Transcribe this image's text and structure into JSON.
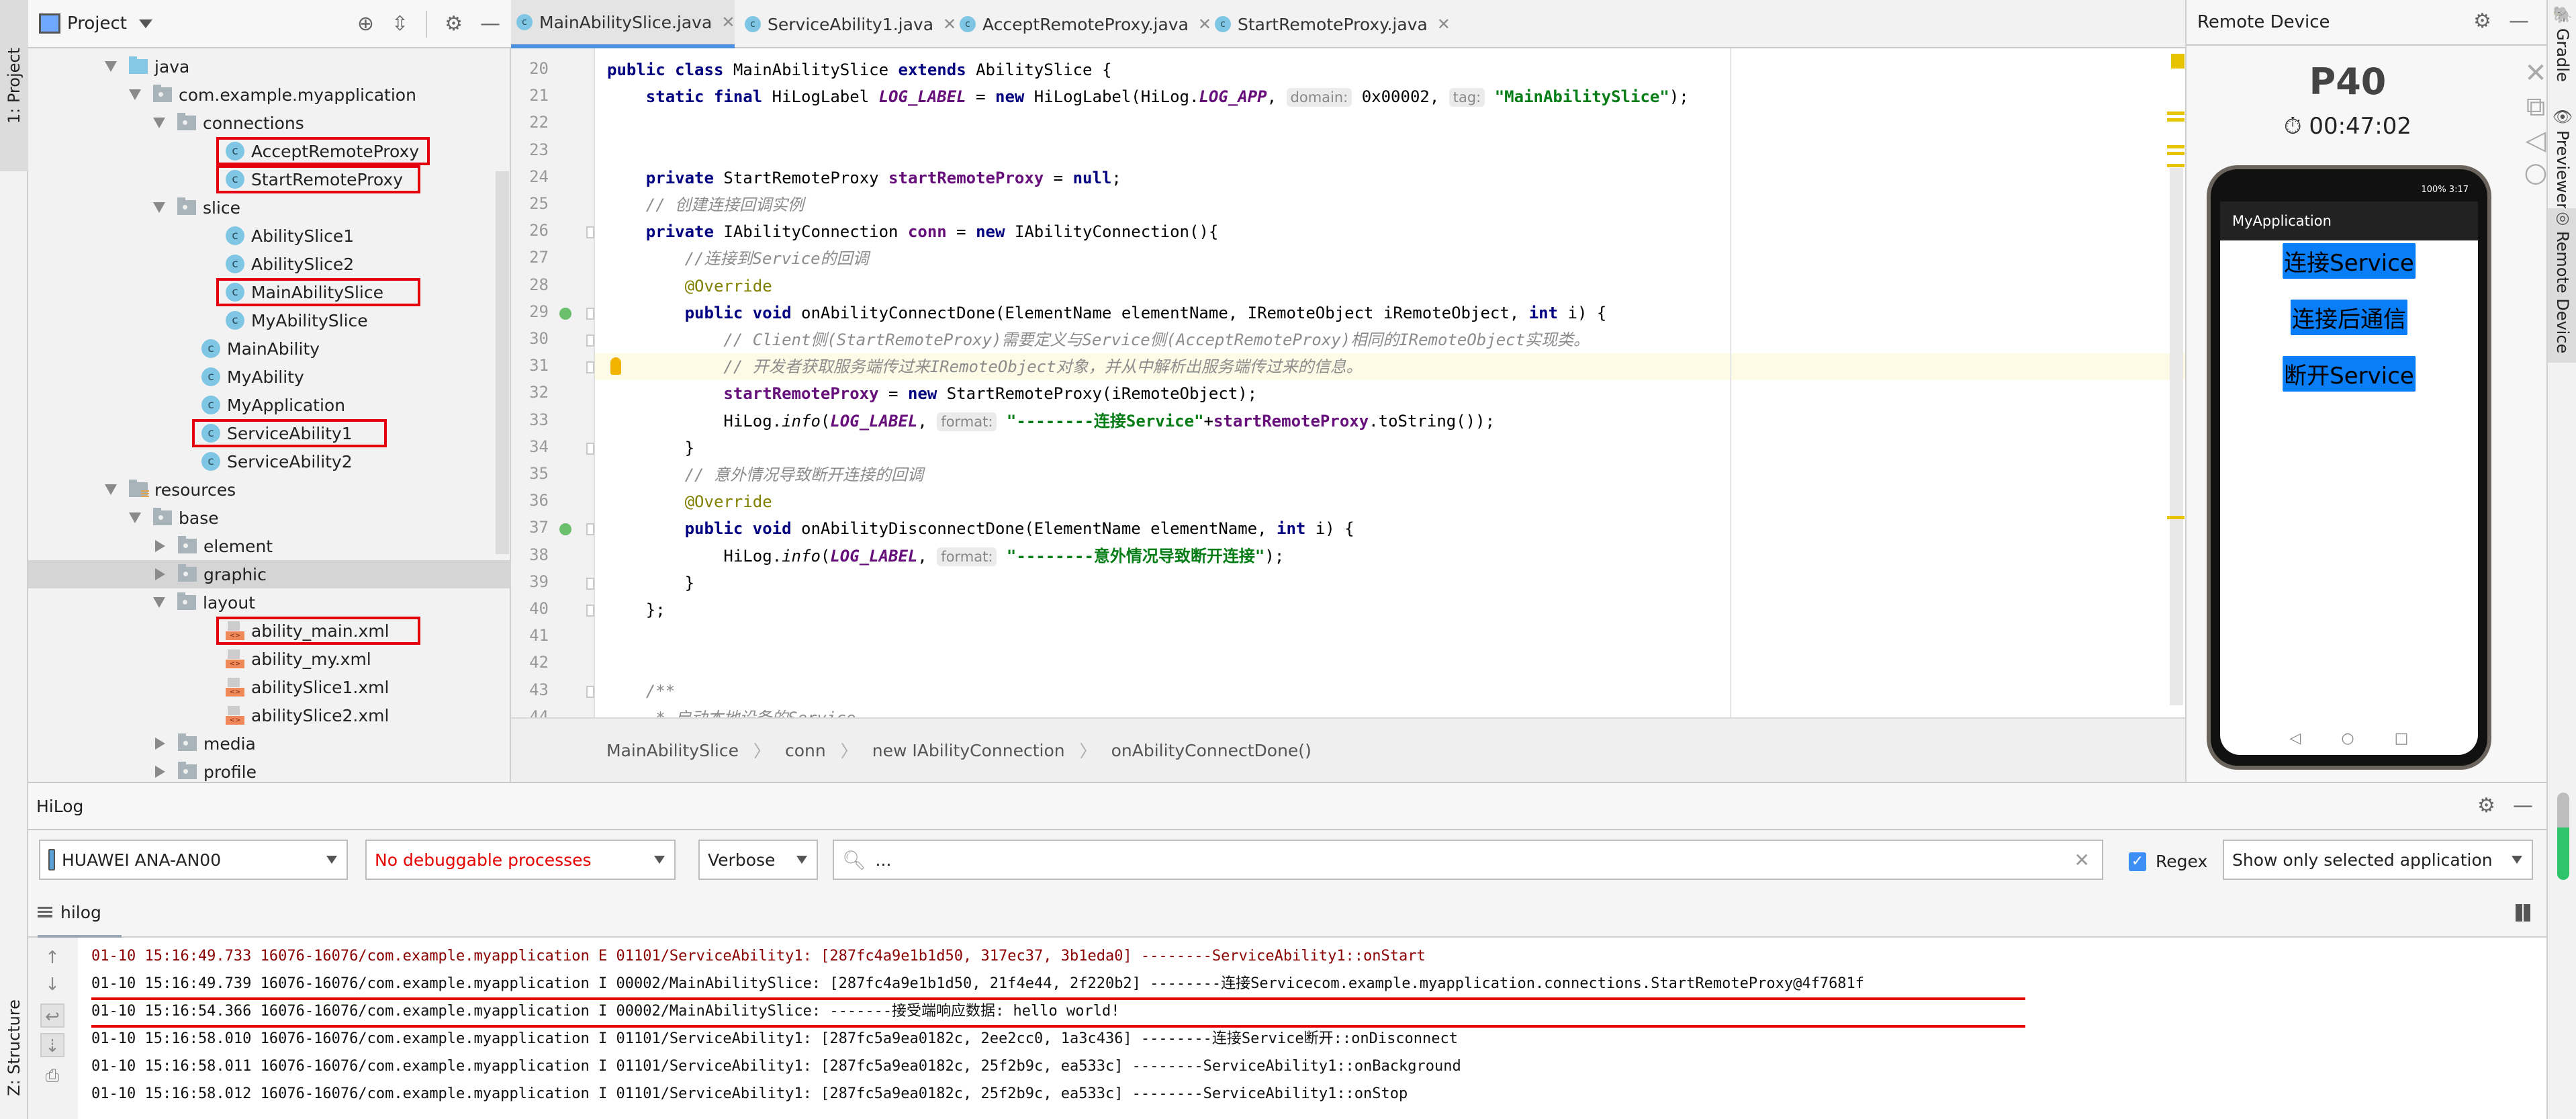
{
  "left_strip": {
    "project_tab": "1: Project",
    "structure_tab": "Z: Structure"
  },
  "project_panel": {
    "title": "Project",
    "icons": [
      "locate-icon",
      "collapse-all-icon",
      "gear-icon",
      "minimize-icon"
    ],
    "tree": [
      {
        "label": "java",
        "type": "source-folder",
        "depth": 0,
        "expanded": true
      },
      {
        "label": "com.example.myapplication",
        "type": "package",
        "depth": 1,
        "expanded": true
      },
      {
        "label": "connections",
        "type": "package",
        "depth": 2,
        "expanded": true
      },
      {
        "label": "AcceptRemoteProxy",
        "type": "class",
        "depth": 3,
        "highlighted": true
      },
      {
        "label": "StartRemoteProxy",
        "type": "class",
        "depth": 3,
        "highlighted": true
      },
      {
        "label": "slice",
        "type": "package",
        "depth": 2,
        "expanded": true
      },
      {
        "label": "AbilitySlice1",
        "type": "class",
        "depth": 3
      },
      {
        "label": "AbilitySlice2",
        "type": "class",
        "depth": 3
      },
      {
        "label": "MainAbilitySlice",
        "type": "class",
        "depth": 3,
        "highlighted": true
      },
      {
        "label": "MyAbilitySlice",
        "type": "class",
        "depth": 3
      },
      {
        "label": "MainAbility",
        "type": "class",
        "depth": 2
      },
      {
        "label": "MyAbility",
        "type": "class",
        "depth": 2
      },
      {
        "label": "MyApplication",
        "type": "class",
        "depth": 2
      },
      {
        "label": "ServiceAbility1",
        "type": "class",
        "depth": 2,
        "highlighted": true
      },
      {
        "label": "ServiceAbility2",
        "type": "class",
        "depth": 2
      },
      {
        "label": "resources",
        "type": "resource-folder",
        "depth": 0,
        "expanded": true
      },
      {
        "label": "base",
        "type": "folder",
        "depth": 1,
        "expanded": true
      },
      {
        "label": "element",
        "type": "folder",
        "depth": 2,
        "expanded": false
      },
      {
        "label": "graphic",
        "type": "folder",
        "depth": 2,
        "expanded": false,
        "selected": true
      },
      {
        "label": "layout",
        "type": "folder",
        "depth": 2,
        "expanded": true
      },
      {
        "label": "ability_main.xml",
        "type": "xml",
        "depth": 3,
        "highlighted": true
      },
      {
        "label": "ability_my.xml",
        "type": "xml",
        "depth": 3
      },
      {
        "label": "abilitySlice1.xml",
        "type": "xml",
        "depth": 3
      },
      {
        "label": "abilitySlice2.xml",
        "type": "xml",
        "depth": 3
      },
      {
        "label": "media",
        "type": "folder",
        "depth": 2,
        "expanded": false
      },
      {
        "label": "profile",
        "type": "folder",
        "depth": 2,
        "expanded": false
      }
    ]
  },
  "editor": {
    "tabs": [
      {
        "label": "MainAbilitySlice.java",
        "active": true
      },
      {
        "label": "ServiceAbility1.java",
        "active": false
      },
      {
        "label": "AcceptRemoteProxy.java",
        "active": false
      },
      {
        "label": "StartRemoteProxy.java",
        "active": false
      }
    ],
    "current_line": 31,
    "lines": [
      {
        "n": 20,
        "t": "public class MainAbilitySlice extends AbilitySlice {"
      },
      {
        "n": 21,
        "t": "    static final HiLogLabel LOG_LABEL = new HiLogLabel(HiLog.LOG_APP, domain: 0x00002, tag: \"MainAbilitySlice\");"
      },
      {
        "n": 22,
        "t": ""
      },
      {
        "n": 23,
        "t": ""
      },
      {
        "n": 24,
        "t": "    private StartRemoteProxy startRemoteProxy = null;"
      },
      {
        "n": 25,
        "t": "    // 创建连接回调实例"
      },
      {
        "n": 26,
        "t": "    private IAbilityConnection conn = new IAbilityConnection(){"
      },
      {
        "n": 27,
        "t": "        //连接到Service的回调"
      },
      {
        "n": 28,
        "t": "        @Override"
      },
      {
        "n": 29,
        "t": "        public void onAbilityConnectDone(ElementName elementName, IRemoteObject iRemoteObject, int i) {"
      },
      {
        "n": 30,
        "t": "            // Client侧(StartRemoteProxy)需要定义与Service侧(AcceptRemoteProxy)相同的IRemoteObject实现类。"
      },
      {
        "n": 31,
        "t": "            // 开发者获取服务端传过来IRemoteObject对象，并从中解析出服务端传过来的信息。"
      },
      {
        "n": 32,
        "t": "            startRemoteProxy = new StartRemoteProxy(iRemoteObject);"
      },
      {
        "n": 33,
        "t": "            HiLog.info(LOG_LABEL, format: \"--------连接Service\"+startRemoteProxy.toString());"
      },
      {
        "n": 34,
        "t": "        }"
      },
      {
        "n": 35,
        "t": "        // 意外情况导致断开连接的回调"
      },
      {
        "n": 36,
        "t": "        @Override"
      },
      {
        "n": 37,
        "t": "        public void onAbilityDisconnectDone(ElementName elementName, int i) {"
      },
      {
        "n": 38,
        "t": "            HiLog.info(LOG_LABEL, format: \"--------意外情况导致断开连接\");"
      },
      {
        "n": 39,
        "t": "        }"
      },
      {
        "n": 40,
        "t": "    };"
      },
      {
        "n": 41,
        "t": ""
      },
      {
        "n": 42,
        "t": ""
      },
      {
        "n": 43,
        "t": "    /**"
      },
      {
        "n": 44,
        "t": "     * 启动本地设备的Service"
      }
    ],
    "breadcrumb": [
      "MainAbilitySlice",
      "conn",
      "new IAbilityConnection",
      "onAbilityConnectDone()"
    ]
  },
  "remote_device": {
    "title": "Remote Device",
    "device_name": "P40",
    "timer": "00:47:02",
    "phone": {
      "status_bar": "100%  3:17",
      "app_title": "MyApplication",
      "buttons": [
        "连接Service",
        "连接后通信",
        "断开Service"
      ]
    },
    "accent_color": "#0a7ef7"
  },
  "right_strip": {
    "tabs": [
      "Gradle",
      "Previewer",
      "Remote Device"
    ]
  },
  "hilog": {
    "title": "HiLog",
    "device": "HUAWEI ANA-AN00",
    "process": "No debuggable processes",
    "level": "Verbose",
    "search_value": "...",
    "regex_label": "Regex",
    "regex_checked": true,
    "filter": "Show only selected application",
    "tab": "hilog",
    "logs": [
      {
        "text": "01-10 15:16:49.733 16076-16076/com.example.myapplication E 01101/ServiceAbility1: [287fc4a9e1b1d50, 317ec37, 3b1eda0] --------ServiceAbility1::onStart",
        "level": "E"
      },
      {
        "text": "01-10 15:16:49.739 16076-16076/com.example.myapplication I 00002/MainAbilitySlice: [287fc4a9e1b1d50, 21f4e44, 2f220b2] --------连接Servicecom.example.myapplication.connections.StartRemoteProxy@4f7681f",
        "level": "I",
        "underlined": true
      },
      {
        "text": "01-10 15:16:54.366 16076-16076/com.example.myapplication I 00002/MainAbilitySlice: -------接受端响应数据: hello world!",
        "level": "I",
        "underlined": true
      },
      {
        "text": "01-10 15:16:58.010 16076-16076/com.example.myapplication I 01101/ServiceAbility1: [287fc5a9ea0182c, 2ee2cc0, 1a3c436] --------连接Service断开::onDisconnect",
        "level": "I"
      },
      {
        "text": "01-10 15:16:58.011 16076-16076/com.example.myapplication I 01101/ServiceAbility1: [287fc5a9ea0182c, 25f2b9c, ea533c] --------ServiceAbility1::onBackground",
        "level": "I"
      },
      {
        "text": "01-10 15:16:58.012 16076-16076/com.example.myapplication I 01101/ServiceAbility1: [287fc5a9ea0182c, 25f2b9c, ea533c] --------ServiceAbility1::onStop",
        "level": "I"
      }
    ]
  }
}
